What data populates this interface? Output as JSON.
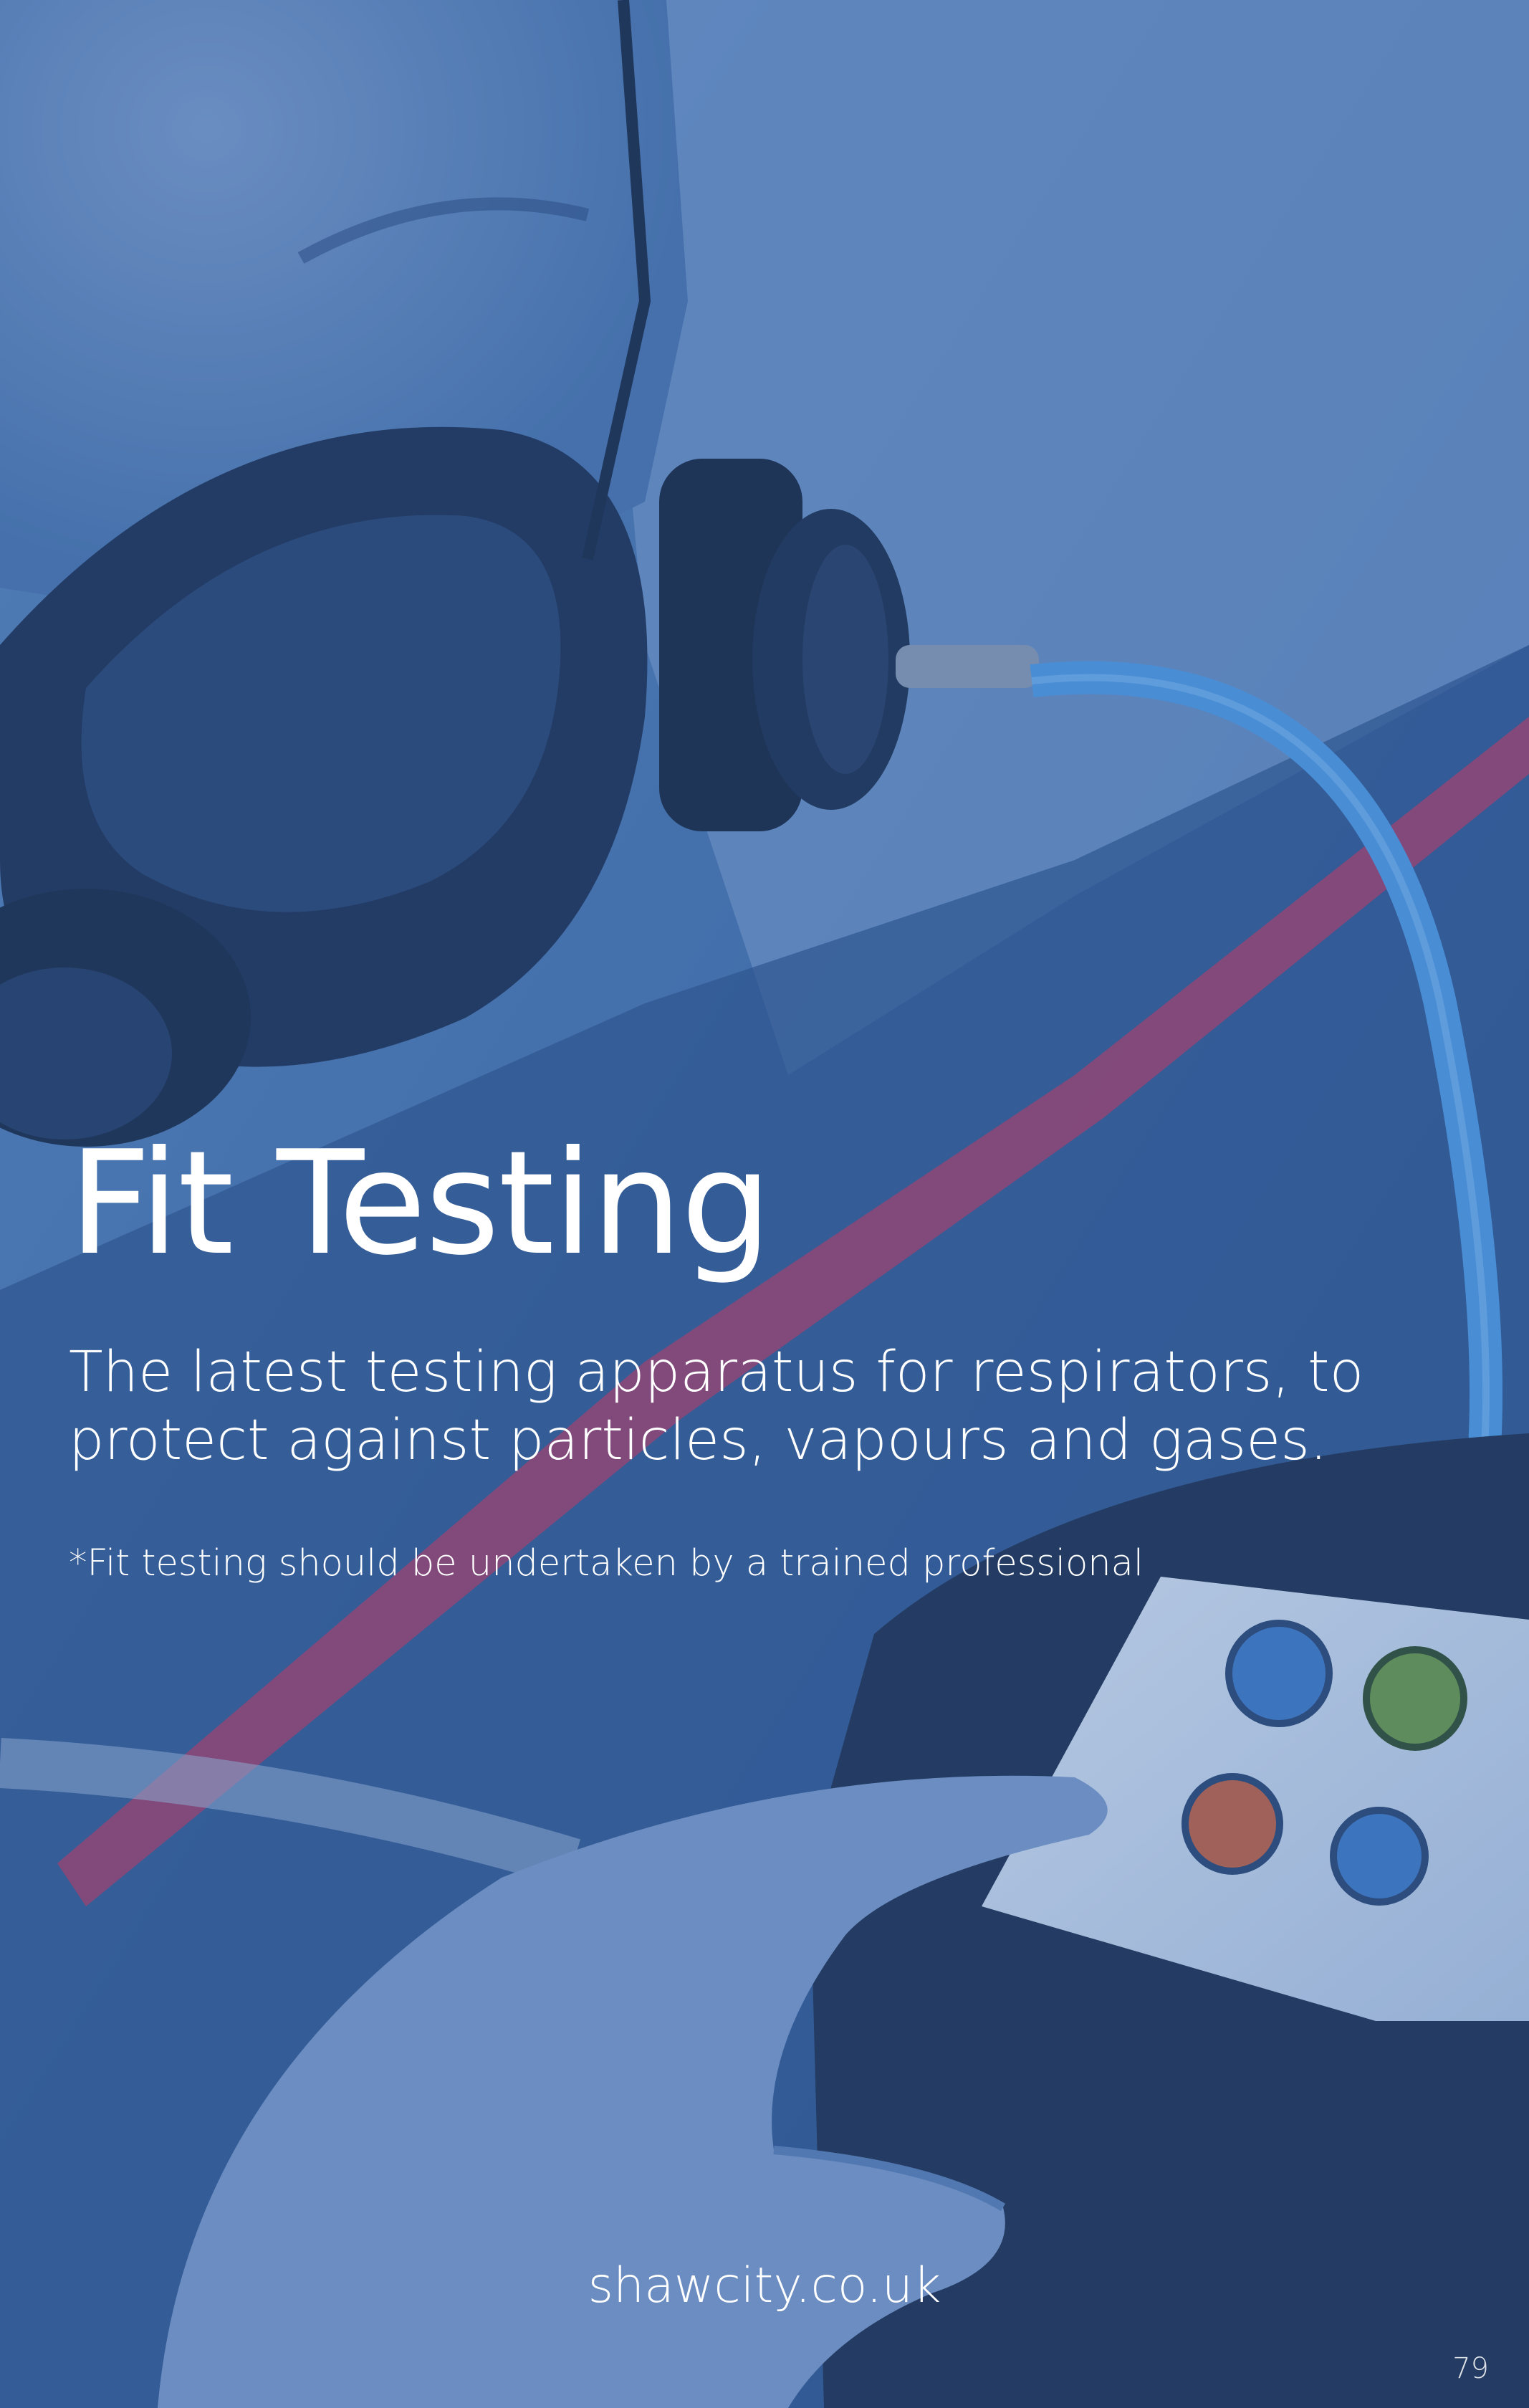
{
  "title": "Fit Testing",
  "subtitle": "The latest testing apparatus for respirators, to protect against particles, vapours and gases.",
  "disclaimer": "*Fit testing should be undertaken by a trained professional",
  "website": "shawcity.co.uk",
  "page_number": "79",
  "colors": {
    "overlay_blue": "#3d6aa5",
    "text": "#ffffff",
    "tube_blue": "#4f9be6",
    "stripe_red": "#b23a63"
  }
}
